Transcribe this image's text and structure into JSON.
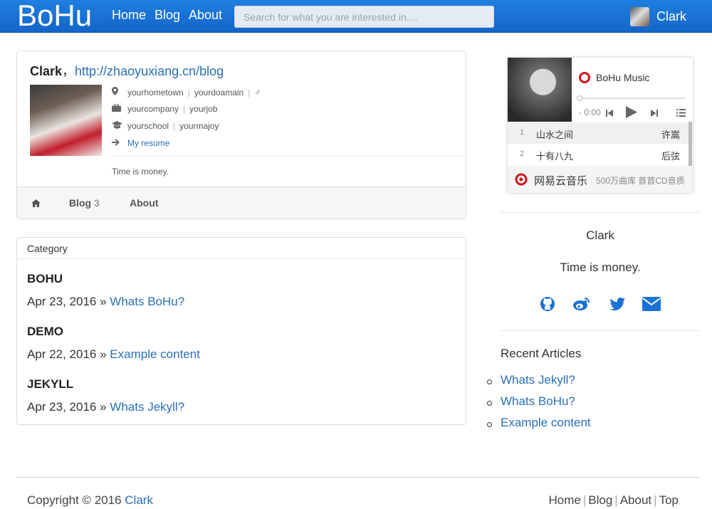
{
  "navbar": {
    "brand": "BoHu",
    "links": [
      "Home",
      "Blog",
      "About"
    ],
    "search_placeholder": "Search for what you are interested in....",
    "user_name": "Clark"
  },
  "profile": {
    "name": "Clark",
    "separator": "，",
    "url": "http://zhaoyuxiang.cn/blog",
    "hometown": "yourhometown",
    "domain": "yourdoamain",
    "gender_symbol": "♂",
    "company": "yourcompany",
    "job": "yourjob",
    "school": "yourschool",
    "major": "yourmajoy",
    "resume": "My resume",
    "motto": "Time is money.",
    "tabs": {
      "blog_label": "Blog",
      "blog_count": "3",
      "about_label": "About"
    }
  },
  "category": {
    "header": "Category",
    "groups": [
      {
        "title": "BOHU",
        "date": "Apr 23, 2016",
        "arrow": "»",
        "post": "Whats BoHu?"
      },
      {
        "title": "DEMO",
        "date": "Apr 22, 2016",
        "arrow": "»",
        "post": "Example content"
      },
      {
        "title": "JEKYLL",
        "date": "Apr 23, 2016",
        "arrow": "»",
        "post": "Whats Jekyll?"
      }
    ]
  },
  "player": {
    "title": "BoHu Music",
    "time": "- 0:00",
    "tracks": [
      {
        "num": "1",
        "name": "山水之间",
        "artist": "许嵩"
      },
      {
        "num": "2",
        "name": "十有八九",
        "artist": "后弦"
      }
    ],
    "footer_name": "网易云音乐",
    "footer_sub": "500万曲库 首首CD音质"
  },
  "sidebar": {
    "name": "Clark",
    "motto": "Time is money.",
    "recent_title": "Recent Articles",
    "recent": [
      "Whats Jekyll?",
      "Whats BoHu?",
      "Example content"
    ]
  },
  "footer": {
    "copyright": "Copyright © 2016 ",
    "owner": "Clark",
    "links": [
      "Home",
      "Blog",
      "About",
      "Top"
    ],
    "separator": "|"
  },
  "colors": {
    "navbar": "#1a72d6",
    "link": "#2a6fb8",
    "netease_red": "#d0161e"
  }
}
